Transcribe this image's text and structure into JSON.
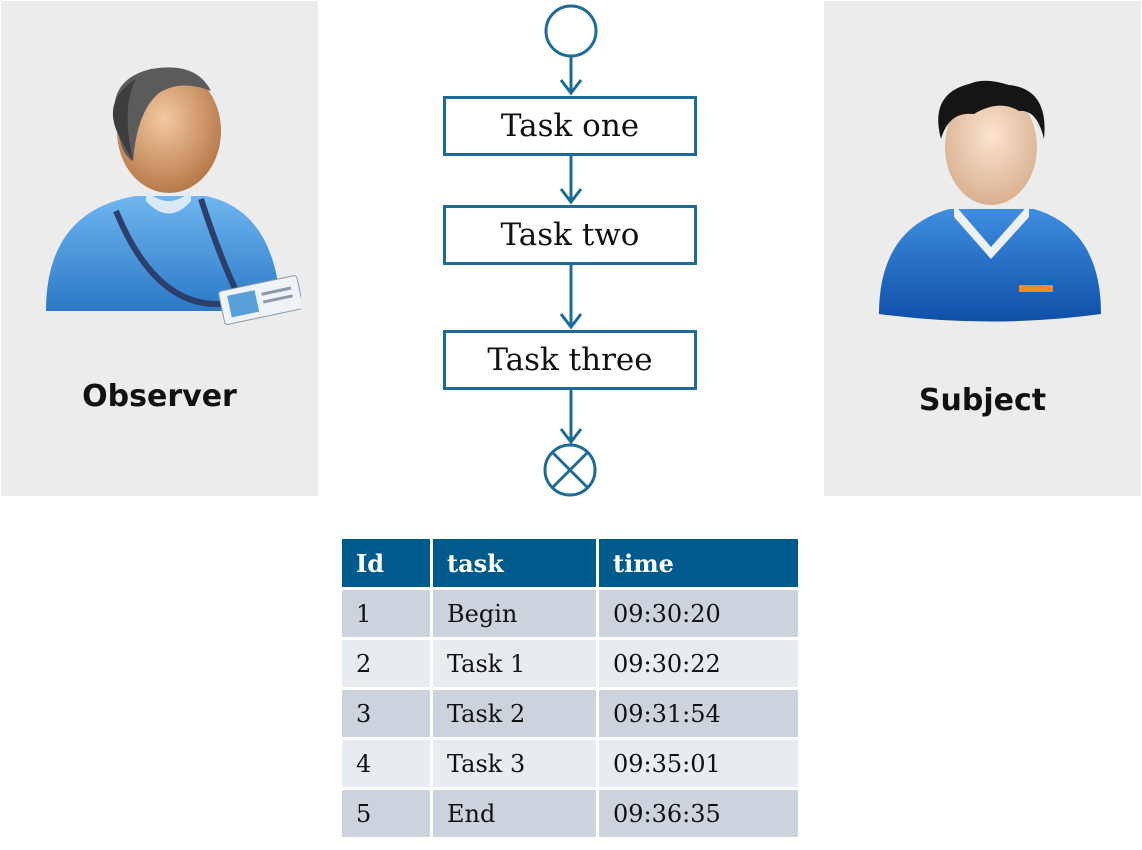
{
  "observer": {
    "label": "Observer",
    "icon": "observer-person-icon"
  },
  "subject": {
    "label": "Subject",
    "icon": "subject-person-icon"
  },
  "flow": {
    "tasks": [
      "Task one",
      "Task two",
      "Task three"
    ],
    "start_icon": "start-node-icon",
    "end_icon": "end-node-icon",
    "color": "#1d6b99"
  },
  "table": {
    "headers": [
      "Id",
      "task",
      "time"
    ],
    "header_color": "#005a8c",
    "rows": [
      [
        "1",
        "Begin",
        "09:30:20"
      ],
      [
        "2",
        "Task 1",
        "09:30:22"
      ],
      [
        "3",
        "Task 2",
        "09:31:54"
      ],
      [
        "4",
        "Task 3",
        "09:35:01"
      ],
      [
        "5",
        "End",
        "09:36:35"
      ]
    ]
  }
}
